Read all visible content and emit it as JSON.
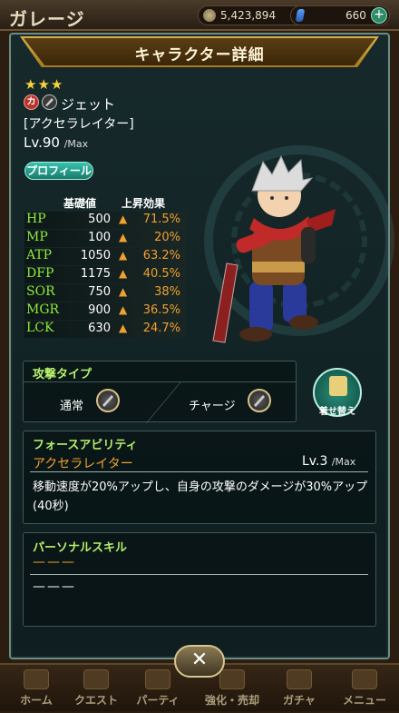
{
  "topbar": {
    "title": "ガレージ",
    "currency": "5,423,894",
    "gems": "660",
    "plus": "+"
  },
  "panel": {
    "title": "キャラクター詳細"
  },
  "character": {
    "stars": "★★★",
    "badge_chara": "カ",
    "name": "ジェット",
    "subtitle": "[アクセラレイター]",
    "level_label": "Lv.90",
    "level_max": "/Max",
    "profile_button": "プロフィール"
  },
  "stats": {
    "base_header": "基礎値",
    "bonus_header": "上昇効果",
    "rows": [
      {
        "name": "HP",
        "value": "500",
        "bonus": "71.5%"
      },
      {
        "name": "MP",
        "value": "100",
        "bonus": "20%"
      },
      {
        "name": "ATP",
        "value": "1050",
        "bonus": "63.2%"
      },
      {
        "name": "DFP",
        "value": "1175",
        "bonus": "40.5%"
      },
      {
        "name": "SOR",
        "value": "750",
        "bonus": "38%"
      },
      {
        "name": "MGR",
        "value": "900",
        "bonus": "36.5%"
      },
      {
        "name": "LCK",
        "value": "630",
        "bonus": "24.7%"
      }
    ]
  },
  "attack": {
    "title": "攻撃タイプ",
    "normal": "通常",
    "charge": "チャージ"
  },
  "dress": {
    "label": "着せ替え"
  },
  "force": {
    "title": "フォースアビリティ",
    "name": "アクセラレイター",
    "level": "Lv.3",
    "level_max": "/Max",
    "description": "移動速度が20%アップし、自身の攻撃のダメージが30%アップ(40秒)"
  },
  "personal": {
    "title": "パーソナルスキル",
    "name": "———",
    "description": "———"
  },
  "close": "✕",
  "nav": {
    "items": [
      "ホーム",
      "クエスト",
      "パーティ",
      "強化・売却",
      "ガチャ",
      "メニュー"
    ]
  },
  "colors": {
    "stat_green": "#8fea3a",
    "bonus_orange": "#f0a030",
    "section_title": "#b6f06a"
  }
}
